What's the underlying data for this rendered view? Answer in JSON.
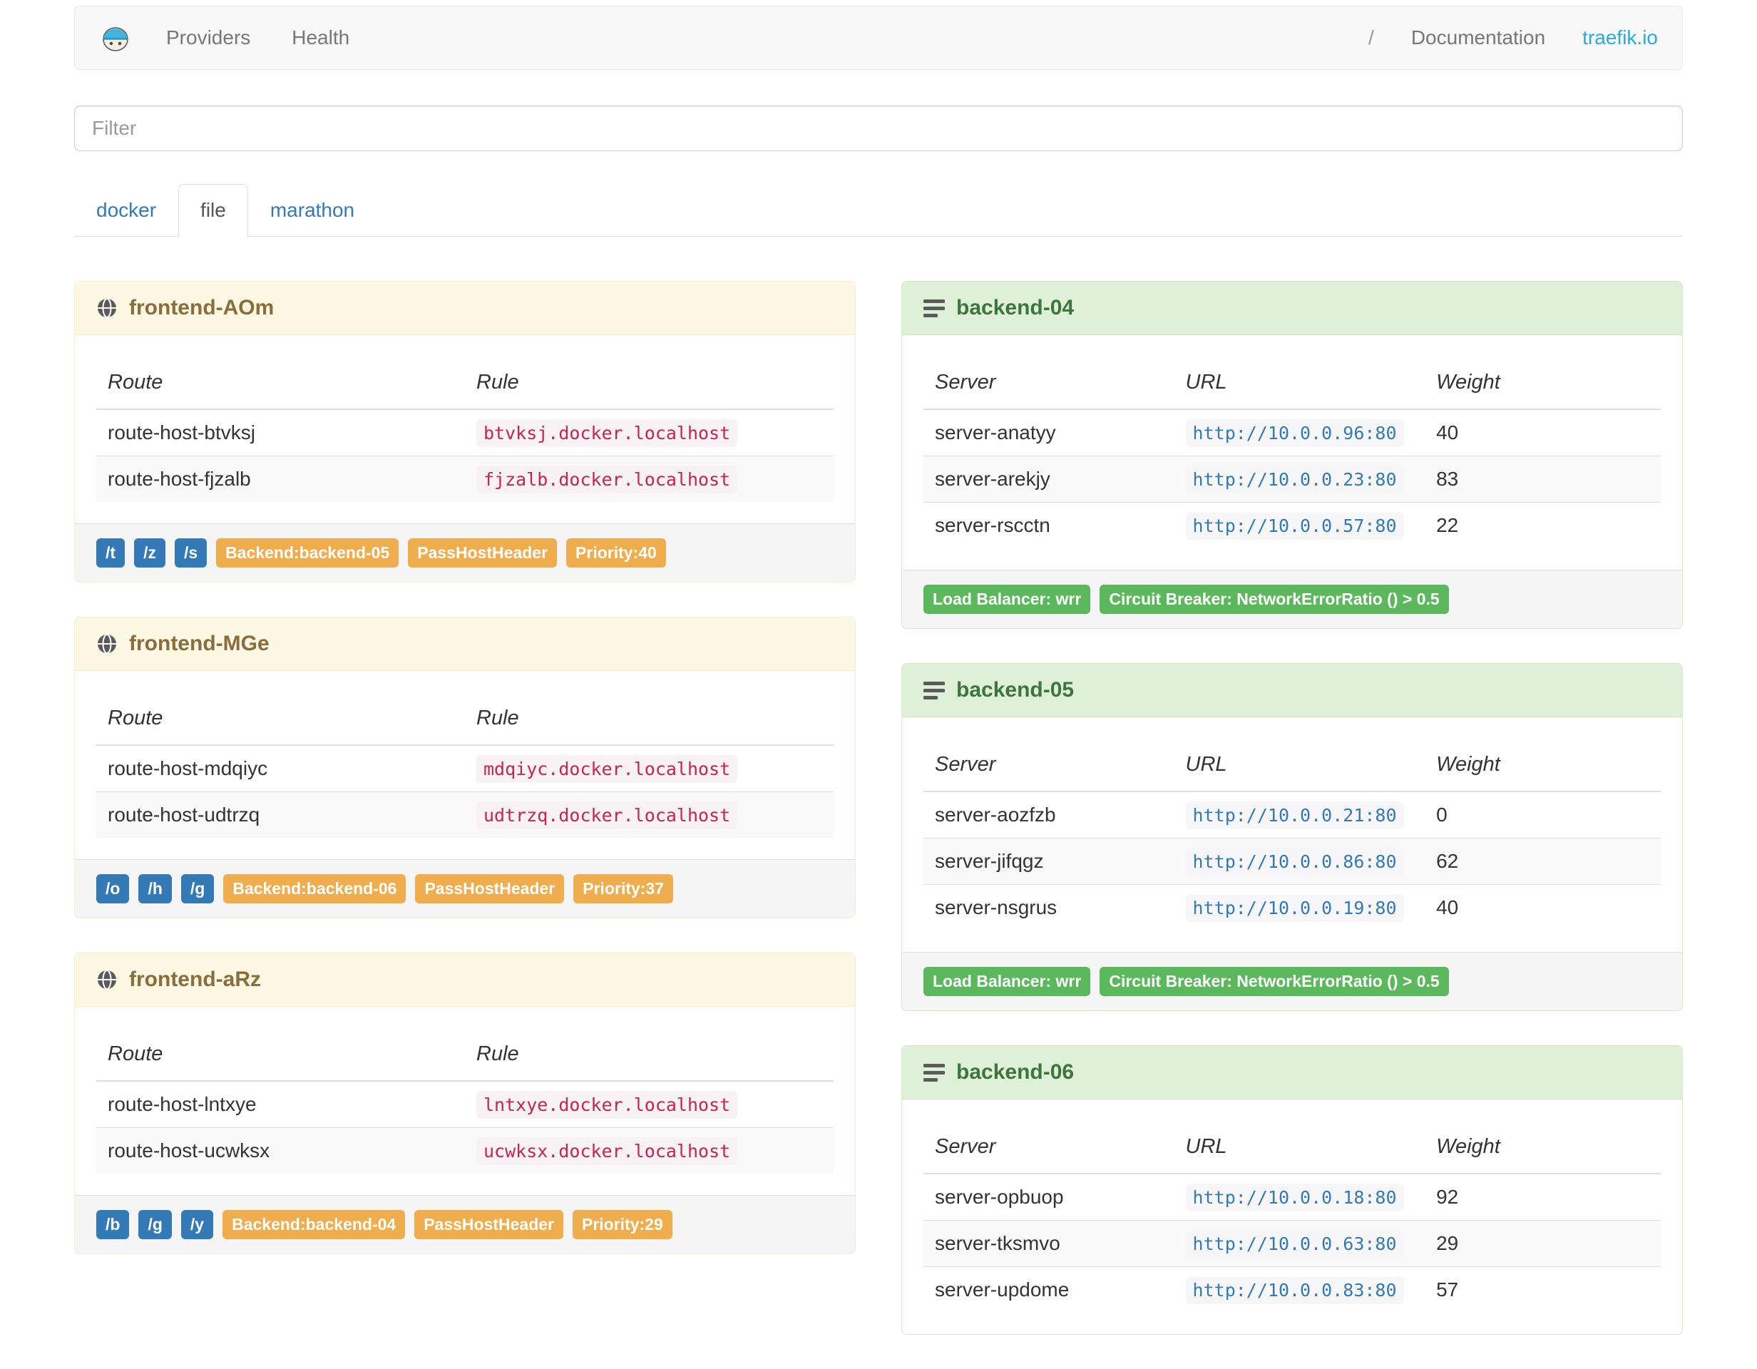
{
  "navbar": {
    "items": [
      {
        "label": "Providers"
      },
      {
        "label": "Health"
      }
    ],
    "right": {
      "separator": "/",
      "documentation": "Documentation",
      "site": "traefik.io"
    }
  },
  "filter": {
    "placeholder": "Filter"
  },
  "tabs": [
    {
      "label": "docker",
      "active": false
    },
    {
      "label": "file",
      "active": true
    },
    {
      "label": "marathon",
      "active": false
    }
  ],
  "frontend_columns": {
    "route": "Route",
    "rule": "Rule"
  },
  "backend_columns": {
    "server": "Server",
    "url": "URL",
    "weight": "Weight"
  },
  "frontends": [
    {
      "title": "frontend-AOm",
      "routes": [
        {
          "route": "route-host-btvksj",
          "rule": "btvksj.docker.localhost"
        },
        {
          "route": "route-host-fjzalb",
          "rule": "fjzalb.docker.localhost"
        }
      ],
      "paths": [
        "/t",
        "/z",
        "/s"
      ],
      "badges": [
        "Backend:backend-05",
        "PassHostHeader",
        "Priority:40"
      ]
    },
    {
      "title": "frontend-MGe",
      "routes": [
        {
          "route": "route-host-mdqiyc",
          "rule": "mdqiyc.docker.localhost"
        },
        {
          "route": "route-host-udtrzq",
          "rule": "udtrzq.docker.localhost"
        }
      ],
      "paths": [
        "/o",
        "/h",
        "/g"
      ],
      "badges": [
        "Backend:backend-06",
        "PassHostHeader",
        "Priority:37"
      ]
    },
    {
      "title": "frontend-aRz",
      "routes": [
        {
          "route": "route-host-lntxye",
          "rule": "lntxye.docker.localhost"
        },
        {
          "route": "route-host-ucwksx",
          "rule": "ucwksx.docker.localhost"
        }
      ],
      "paths": [
        "/b",
        "/g",
        "/y"
      ],
      "badges": [
        "Backend:backend-04",
        "PassHostHeader",
        "Priority:29"
      ]
    }
  ],
  "backends": [
    {
      "title": "backend-04",
      "servers": [
        {
          "name": "server-anatyy",
          "url": "http://10.0.0.96:80",
          "weight": "40"
        },
        {
          "name": "server-arekjy",
          "url": "http://10.0.0.23:80",
          "weight": "83"
        },
        {
          "name": "server-rscctn",
          "url": "http://10.0.0.57:80",
          "weight": "22"
        }
      ],
      "badges": [
        "Load Balancer: wrr",
        "Circuit Breaker: NetworkErrorRatio () > 0.5"
      ]
    },
    {
      "title": "backend-05",
      "servers": [
        {
          "name": "server-aozfzb",
          "url": "http://10.0.0.21:80",
          "weight": "0"
        },
        {
          "name": "server-jifqgz",
          "url": "http://10.0.0.86:80",
          "weight": "62"
        },
        {
          "name": "server-nsgrus",
          "url": "http://10.0.0.19:80",
          "weight": "40"
        }
      ],
      "badges": [
        "Load Balancer: wrr",
        "Circuit Breaker: NetworkErrorRatio () > 0.5"
      ]
    },
    {
      "title": "backend-06",
      "servers": [
        {
          "name": "server-opbuop",
          "url": "http://10.0.0.18:80",
          "weight": "92"
        },
        {
          "name": "server-tksmvo",
          "url": "http://10.0.0.63:80",
          "weight": "29"
        },
        {
          "name": "server-updome",
          "url": "http://10.0.0.83:80",
          "weight": "57"
        }
      ]
    }
  ],
  "colors": {
    "accent_blue": "#337ab7",
    "brand_blue": "#29abe2",
    "warning_orange": "#f0ad4e",
    "success_green": "#5cb85c",
    "code_pink": "#c7254e",
    "frontend_header_bg": "#fcf8e3",
    "frontend_header_text": "#8a6d3b",
    "backend_header_bg": "#dff0d8",
    "backend_header_text": "#3c763d"
  }
}
